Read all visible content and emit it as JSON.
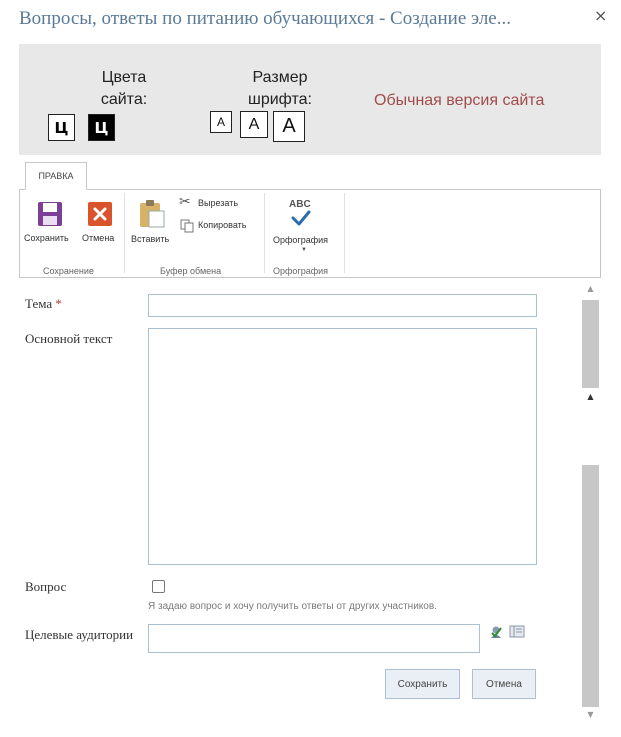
{
  "dialog": {
    "title": "Вопросы, ответы по питанию обучающихся - Создание эле...",
    "close_glyph": "×"
  },
  "accessibility": {
    "colors_label_line1": "Цвета",
    "colors_label_line2": "сайта:",
    "color_options": [
      "Ц",
      "Ц"
    ],
    "font_size_label_line1": "Размер",
    "font_size_label_line2": "шрифта:",
    "font_size_options": [
      "A",
      "A",
      "A"
    ],
    "normal_version_link": "Обычная версия сайта"
  },
  "ribbon": {
    "tab": "ПРАВКА",
    "save_label": "Сохранить",
    "cancel_label": "Отмена",
    "paste_label": "Вставить",
    "cut_label": "Вырезать",
    "copy_label": "Копировать",
    "spelling_label": "Орфография",
    "spelling_icon_text": "ABC",
    "group_save": "Сохранение",
    "group_clipboard": "Буфер обмена",
    "group_spelling": "Орфография"
  },
  "form": {
    "subject_label": "Тема",
    "required_mark": "*",
    "subject_value": "",
    "body_label": "Основной текст",
    "body_value": "",
    "question_label": "Вопрос",
    "question_checked": false,
    "question_hint": "Я задаю вопрос и хочу получить ответы от других участников.",
    "audience_label": "Целевые аудитории",
    "audience_value": "",
    "save_button": "Сохранить",
    "cancel_button": "Отмена"
  },
  "colors": {
    "title": "#5a7a96",
    "access_bg": "#e8e8e8",
    "normal_link": "#a14c4c",
    "save_icon": "#7b3f95",
    "cancel_icon": "#d9532c",
    "spell_check": "#2b6cb0",
    "input_border": "#abc0d0",
    "button_bg": "#e9eff4"
  },
  "icons": {
    "save": "floppy-disk-icon",
    "cancel": "red-x-icon",
    "paste": "clipboard-icon",
    "cut": "scissors-icon",
    "copy": "copy-pages-icon",
    "spelling": "abc-checkmark-icon",
    "people_picker": "check-names-icon",
    "address_book": "address-book-icon"
  }
}
